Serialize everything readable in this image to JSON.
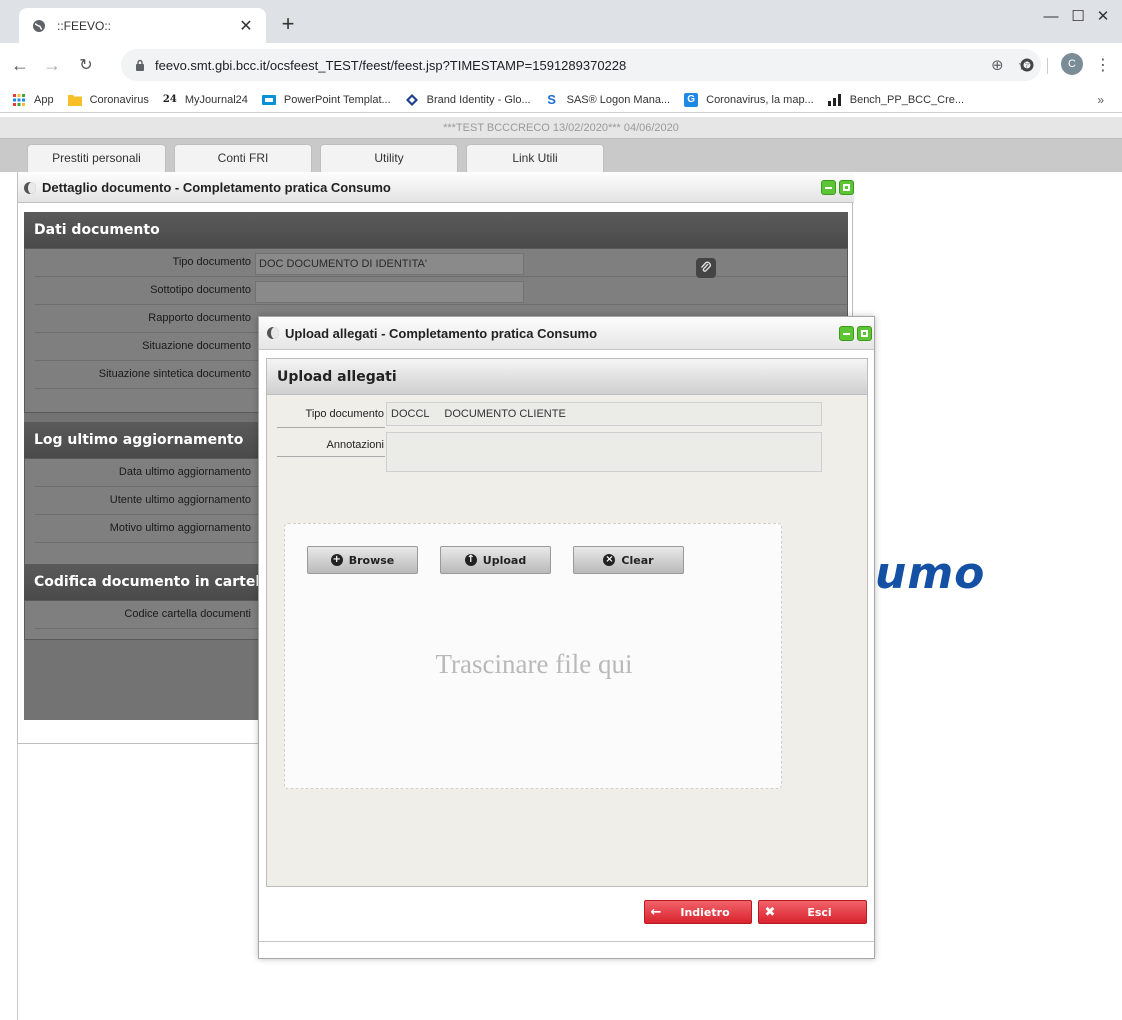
{
  "browser": {
    "tab_title": "::FEEVO::",
    "url": "feevo.smt.gbi.bcc.it/ocsfeest_TEST/feest/feest.jsp?TIMESTAMP=1591289370228",
    "profile_initial": "C",
    "bookmarks": [
      {
        "label": "App",
        "icon": "apps-grid-icon"
      },
      {
        "label": "Coronavirus",
        "icon": "folder-icon"
      },
      {
        "label": "MyJournal24",
        "icon": "journal-logo-icon"
      },
      {
        "label": "PowerPoint Templat...",
        "icon": "slides-icon"
      },
      {
        "label": "Brand Identity - Glo...",
        "icon": "diamond-icon"
      },
      {
        "label": "SAS® Logon Mana...",
        "icon": "sas-icon"
      },
      {
        "label": "Coronavirus, la map...",
        "icon": "map-icon"
      },
      {
        "label": "Bench_PP_BCC_Cre...",
        "icon": "bars-icon"
      }
    ]
  },
  "app": {
    "env_banner": "***TEST BCCCRECO 13/02/2020***  04/06/2020",
    "menu_tabs": [
      "Prestiti personali",
      "Conti FRI",
      "Utility",
      "Link Utili"
    ],
    "watermark": "umo"
  },
  "detail_panel": {
    "title": "Dettaglio documento - Completamento pratica Consumo",
    "sections": [
      {
        "title": "Dati documento",
        "fields": [
          {
            "label": "Tipo documento",
            "value": "DOC DOCUMENTO DI IDENTITA'"
          },
          {
            "label": "Sottotipo documento",
            "value": ""
          },
          {
            "label": "Rapporto documento",
            "value": ""
          },
          {
            "label": "Situazione documento",
            "value": ""
          },
          {
            "label": "Situazione sintetica documento",
            "value": ""
          }
        ]
      },
      {
        "title": "Log ultimo aggiornamento",
        "fields": [
          {
            "label": "Data ultimo aggiornamento",
            "value": ""
          },
          {
            "label": "Utente ultimo aggiornamento",
            "value": ""
          },
          {
            "label": "Motivo ultimo aggiornamento",
            "value": ""
          }
        ]
      },
      {
        "title": "Codifica documento in cartella",
        "fields": [
          {
            "label": "Codice cartella documenti",
            "value": ""
          }
        ]
      }
    ]
  },
  "upload_modal": {
    "title": "Upload allegati - Completamento pratica Consumo",
    "section_title": "Upload allegati",
    "tipo_documento_label": "Tipo documento",
    "tipo_documento_value": "DOCCL     DOCUMENTO CLIENTE",
    "annotazioni_label": "Annotazioni",
    "annotazioni_value": "",
    "browse_label": "Browse",
    "upload_label": "Upload",
    "clear_label": "Clear",
    "drop_hint": "Trascinare file qui",
    "back_label": "Indietro",
    "exit_label": "Esci"
  },
  "colors": {
    "accent_green": "#5dc535",
    "danger_red": "#d9232d",
    "brand_blue": "#1450a3"
  }
}
